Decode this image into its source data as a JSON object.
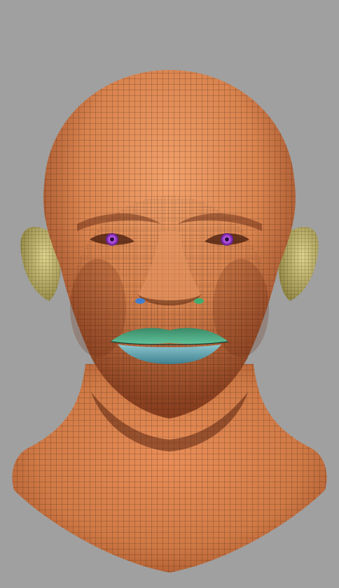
{
  "scene": {
    "background_color": "#a0a0a0",
    "skin_color": "#d9834e",
    "skin_light_color": "#f0a06e",
    "skin_shadow_color": "#7a3a1c",
    "wire_color": "#2a1408",
    "ear_color": "#cfc27a",
    "iris_color": "#a040d0",
    "upper_lip_color": "#4fae85",
    "lower_lip_color": "#6aa9b3",
    "nostril_left_color": "#3f7fd0",
    "nostril_right_color": "#3fae70"
  }
}
